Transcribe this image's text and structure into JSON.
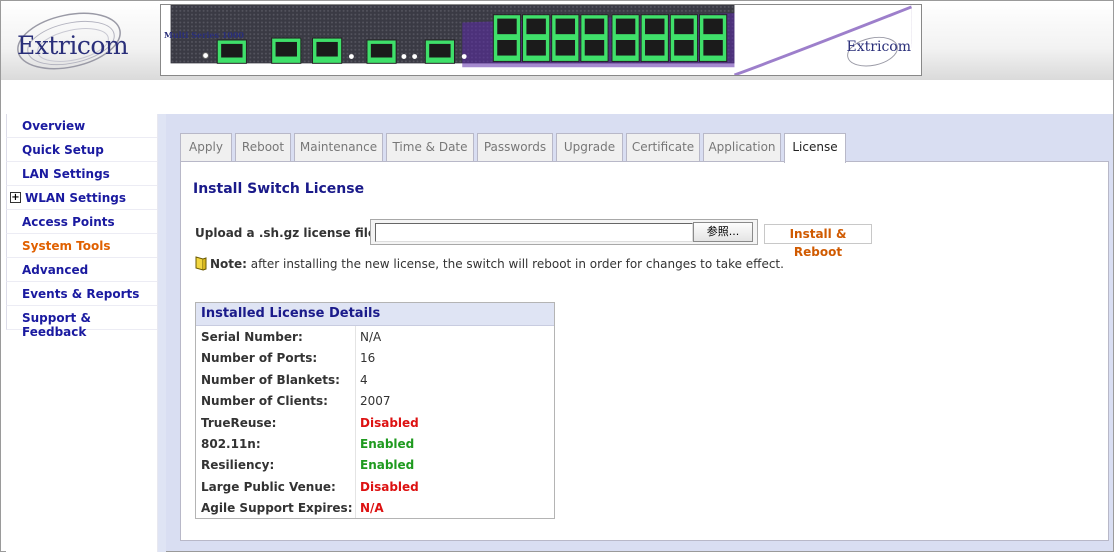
{
  "brand": {
    "logo_text": "Extricom",
    "device_model": "Multi Series 1000",
    "device_logo": "Extricom"
  },
  "sidebar": {
    "items": [
      {
        "label": "Overview",
        "active": false,
        "expandable": false
      },
      {
        "label": "Quick Setup",
        "active": false,
        "expandable": false
      },
      {
        "label": "LAN Settings",
        "active": false,
        "expandable": false
      },
      {
        "label": "WLAN Settings",
        "active": false,
        "expandable": true
      },
      {
        "label": "Access Points",
        "active": false,
        "expandable": false
      },
      {
        "label": "System Tools",
        "active": true,
        "expandable": false
      },
      {
        "label": "Advanced",
        "active": false,
        "expandable": false
      },
      {
        "label": "Events & Reports",
        "active": false,
        "expandable": false
      },
      {
        "label": "Support & Feedback",
        "active": false,
        "expandable": false
      }
    ],
    "expand_symbol": "+"
  },
  "tabs": [
    {
      "label": "Apply"
    },
    {
      "label": "Reboot"
    },
    {
      "label": "Maintenance"
    },
    {
      "label": "Time & Date"
    },
    {
      "label": "Passwords"
    },
    {
      "label": "Upgrade"
    },
    {
      "label": "Certificate"
    },
    {
      "label": "Application"
    },
    {
      "label": "License",
      "active": true
    }
  ],
  "main": {
    "title": "Install Switch License",
    "upload_label": "Upload a .sh.gz license file:",
    "file_value": "",
    "browse_label": "参照...",
    "install_label": "Install & Reboot",
    "note_prefix": "Note:",
    "note_text": " after installing the new license, the switch will reboot in order for changes to take effect."
  },
  "details": {
    "heading": "Installed License Details",
    "rows": [
      {
        "key": "Serial Number:",
        "value": "N/A",
        "style": "plain"
      },
      {
        "key": "Number of Ports:",
        "value": "16",
        "style": "plain"
      },
      {
        "key": "Number of Blankets:",
        "value": "4",
        "style": "plain"
      },
      {
        "key": "Number of Clients:",
        "value": "2007",
        "style": "plain"
      },
      {
        "key": "TrueReuse:",
        "value": "Disabled",
        "style": "red"
      },
      {
        "key": "802.11n:",
        "value": "Enabled",
        "style": "green"
      },
      {
        "key": "Resiliency:",
        "value": "Enabled",
        "style": "green"
      },
      {
        "key": "Large Public Venue:",
        "value": "Disabled",
        "style": "red"
      },
      {
        "key": "Agile Support Expires:",
        "value": "N/A",
        "style": "red"
      }
    ]
  },
  "colors": {
    "nav_link": "#1a1aa0",
    "nav_active": "#e06000",
    "panel_band": "#d9def2",
    "port_green": "#3fe06a",
    "enabled": "#1f9a1f",
    "disabled": "#dd1111"
  }
}
